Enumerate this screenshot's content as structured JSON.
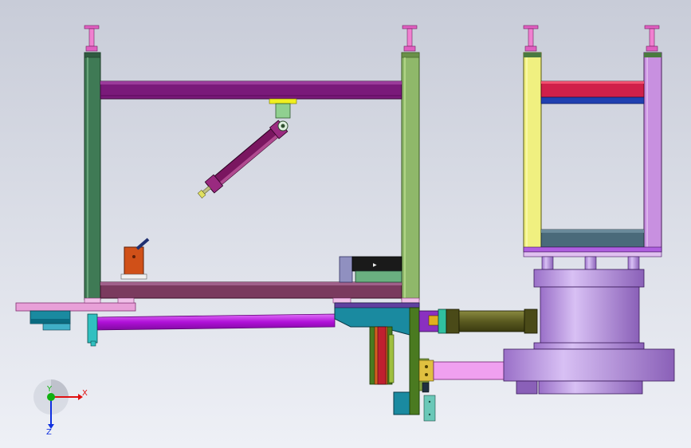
{
  "viewport": {
    "background_top": "#c8ccd8",
    "background_bottom": "#eef0f6"
  },
  "triad": {
    "x_label": "X",
    "y_label": "Y",
    "z_label": "Z",
    "x_color": "#e01010",
    "y_color": "#10b010",
    "z_color": "#1030e0"
  },
  "colors": {
    "frame_post_left": "#3f7a55",
    "frame_post_right": "#8fb86a",
    "crossbeam": "#7a1a7a",
    "base_beam": "#7a3a5e",
    "base_plate": "#e8a0d8",
    "cylinder_body": "#7a1660",
    "purple_rod": "#c020e0",
    "teal_block": "#1a8aa0",
    "olive_cylinder": "#6a6a28",
    "pink_rod": "#f0a0f0",
    "lavender_body": "#b890e0",
    "yellow_post": "#f0f080",
    "red_beam": "#d0204a",
    "blue_strip": "#2040b0",
    "slate_plate": "#4a6a7a",
    "orange_clamp": "#d05018",
    "magenta_knob": "#e060c0"
  }
}
